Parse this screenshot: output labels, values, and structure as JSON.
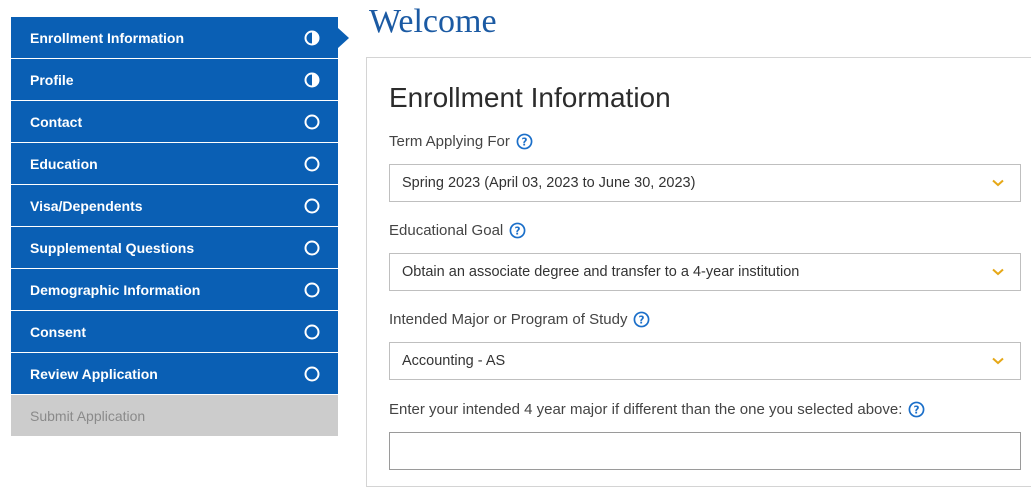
{
  "sidebar": {
    "items": [
      {
        "label": "Enrollment Information",
        "status": "half"
      },
      {
        "label": "Profile",
        "status": "half"
      },
      {
        "label": "Contact",
        "status": "empty"
      },
      {
        "label": "Education",
        "status": "empty"
      },
      {
        "label": "Visa/Dependents",
        "status": "empty"
      },
      {
        "label": "Supplemental Questions",
        "status": "empty"
      },
      {
        "label": "Demographic Information",
        "status": "empty"
      },
      {
        "label": "Consent",
        "status": "empty"
      },
      {
        "label": "Review Application",
        "status": "empty"
      },
      {
        "label": "Submit Application",
        "status": "disabled"
      }
    ]
  },
  "page": {
    "title": "Welcome"
  },
  "section": {
    "title": "Enrollment Information"
  },
  "fields": {
    "term": {
      "label": "Term Applying For",
      "value": "Spring 2023 (April 03, 2023 to June 30, 2023)"
    },
    "goal": {
      "label": "Educational Goal",
      "value": "Obtain an associate degree and transfer to a 4-year institution"
    },
    "major": {
      "label": "Intended Major or Program of Study",
      "value": "Accounting - AS"
    },
    "intended_major": {
      "label": "Enter your intended 4 year major if different than the one you selected above:",
      "value": ""
    }
  },
  "colors": {
    "nav_blue": "#0a5fb4",
    "heading_blue": "#1b5aa3",
    "chevron": "#e6a817",
    "help_blue": "#1b6fc9",
    "disabled_gray": "#cccccc"
  }
}
